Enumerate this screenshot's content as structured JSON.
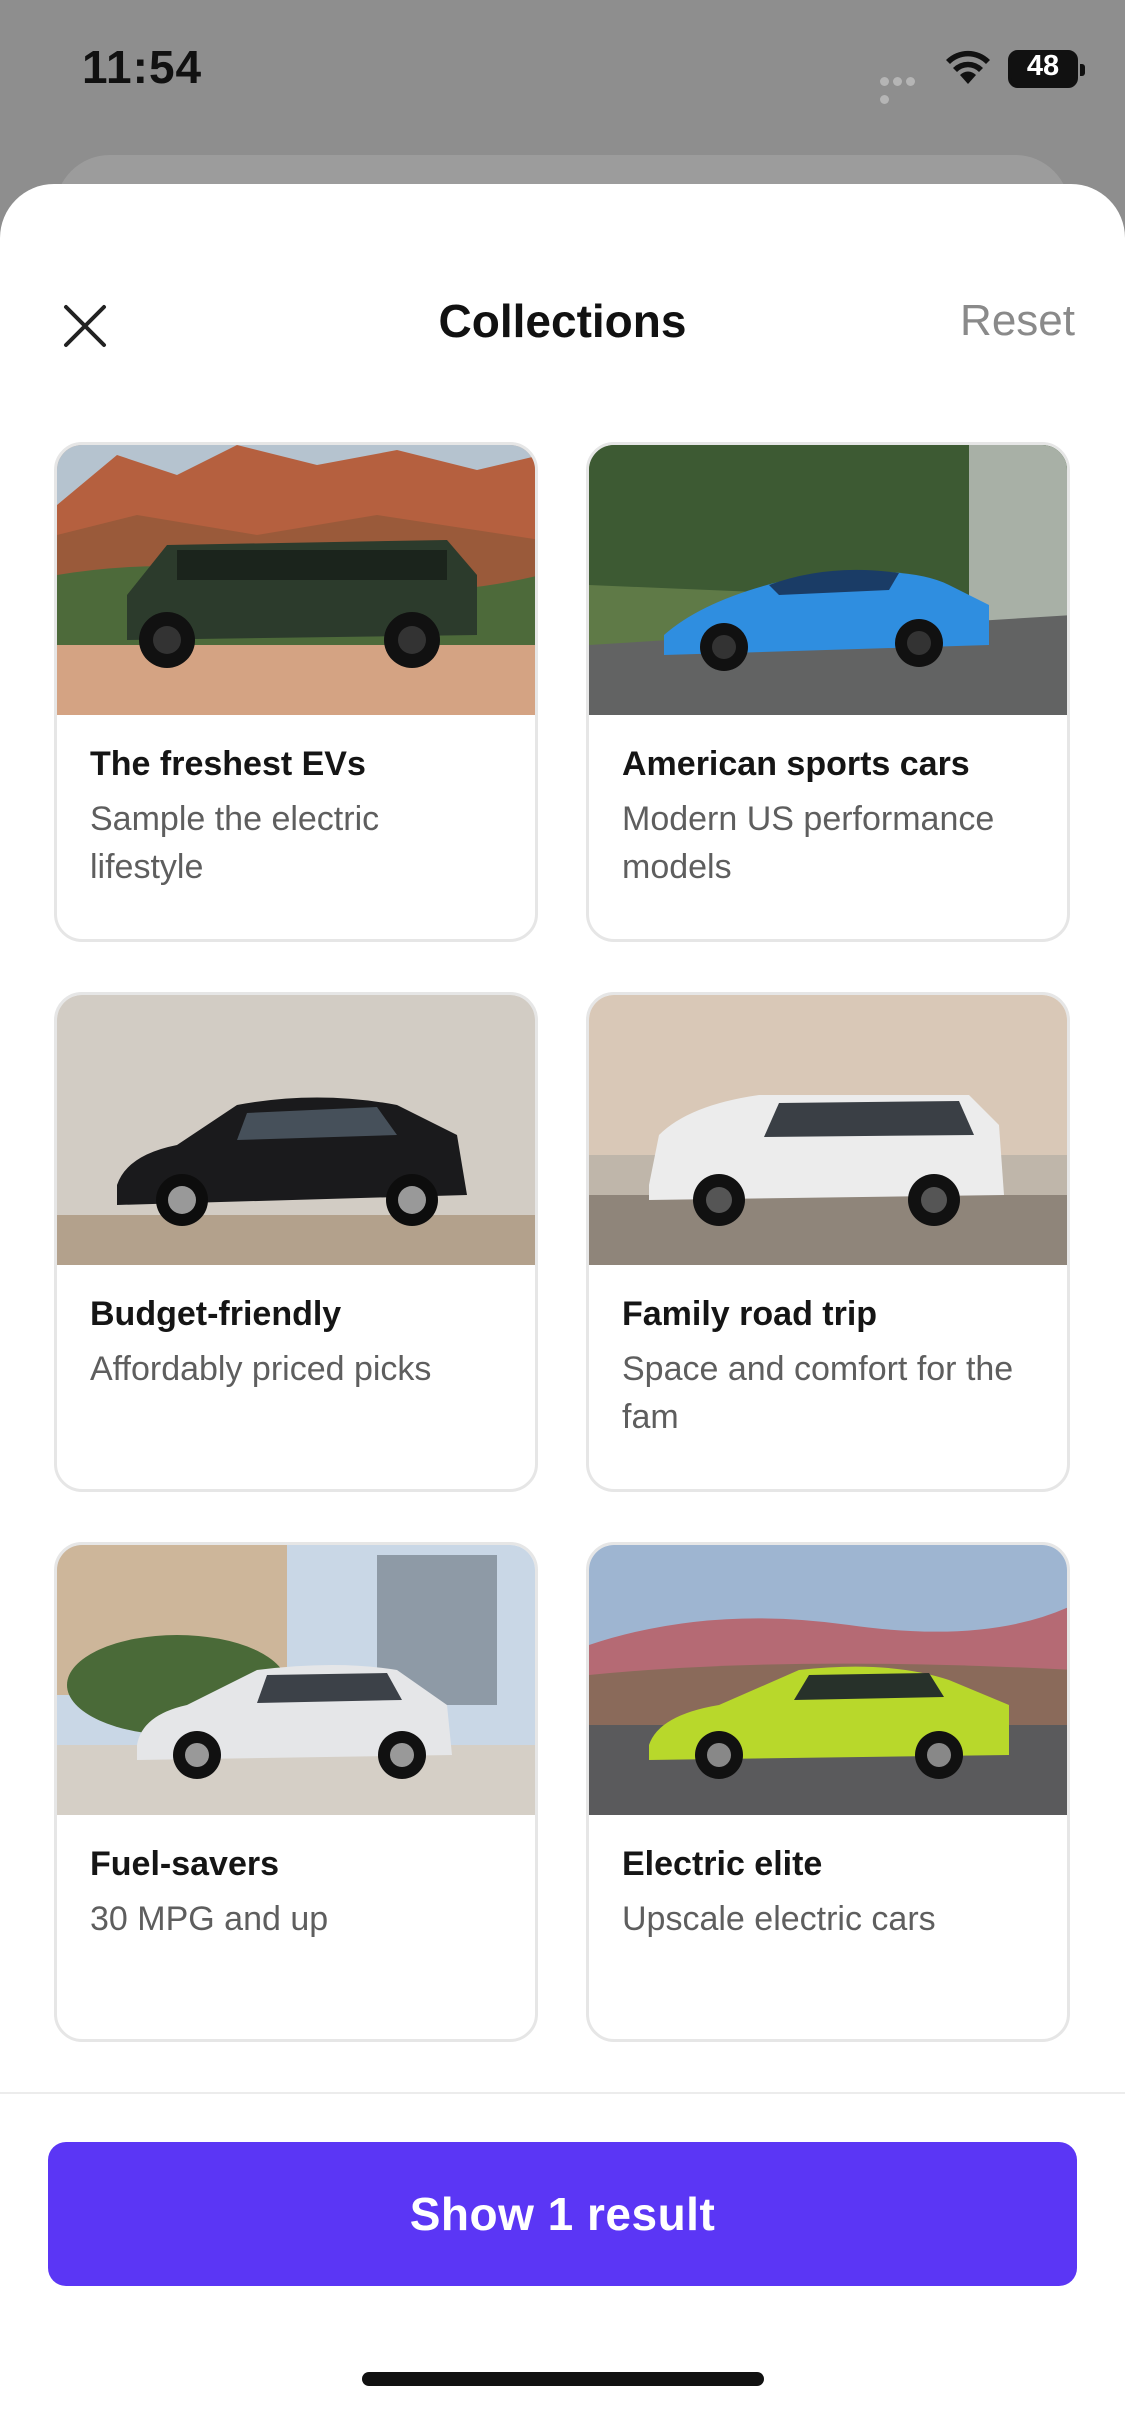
{
  "status_bar": {
    "time": "11:54",
    "battery": "48"
  },
  "header": {
    "title": "Collections",
    "reset_label": "Reset"
  },
  "collections": [
    {
      "title": "The freshest EVs",
      "subtitle": "Sample the electric lifestyle"
    },
    {
      "title": "American sports cars",
      "subtitle": "Modern US performance models"
    },
    {
      "title": "Budget-friendly",
      "subtitle": "Affordably priced picks"
    },
    {
      "title": "Family road trip",
      "subtitle": "Space and comfort for the fam"
    },
    {
      "title": "Fuel-savers",
      "subtitle": "30 MPG and up"
    },
    {
      "title": "Electric elite",
      "subtitle": "Upscale electric cars"
    }
  ],
  "footer": {
    "cta_label": "Show 1 result"
  },
  "colors": {
    "accent": "#5b36f5",
    "reset": "#8a8a8a"
  }
}
